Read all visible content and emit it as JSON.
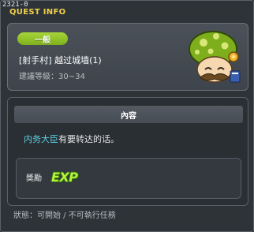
{
  "quest_id": "2321-0",
  "window_title": "QUEST INFO",
  "category": "一般",
  "quest_name": "[射手村] 越过城墙(1)",
  "level_requirement": "建議等級：30~34",
  "npc_icon": "green-mushroom-npc-icon",
  "content_header": "內容",
  "dialogue": {
    "npc_name": "内务大臣",
    "text": "有要转达的话。"
  },
  "reward": {
    "label": "獎勵",
    "exp_label": "EXP"
  },
  "status": "狀態：可開始 / 不可執行任務",
  "colors": {
    "title": "#f2d04a",
    "badge": "#8cc023",
    "npc_name": "#5fd0e8",
    "exp": "#b7f23a"
  }
}
